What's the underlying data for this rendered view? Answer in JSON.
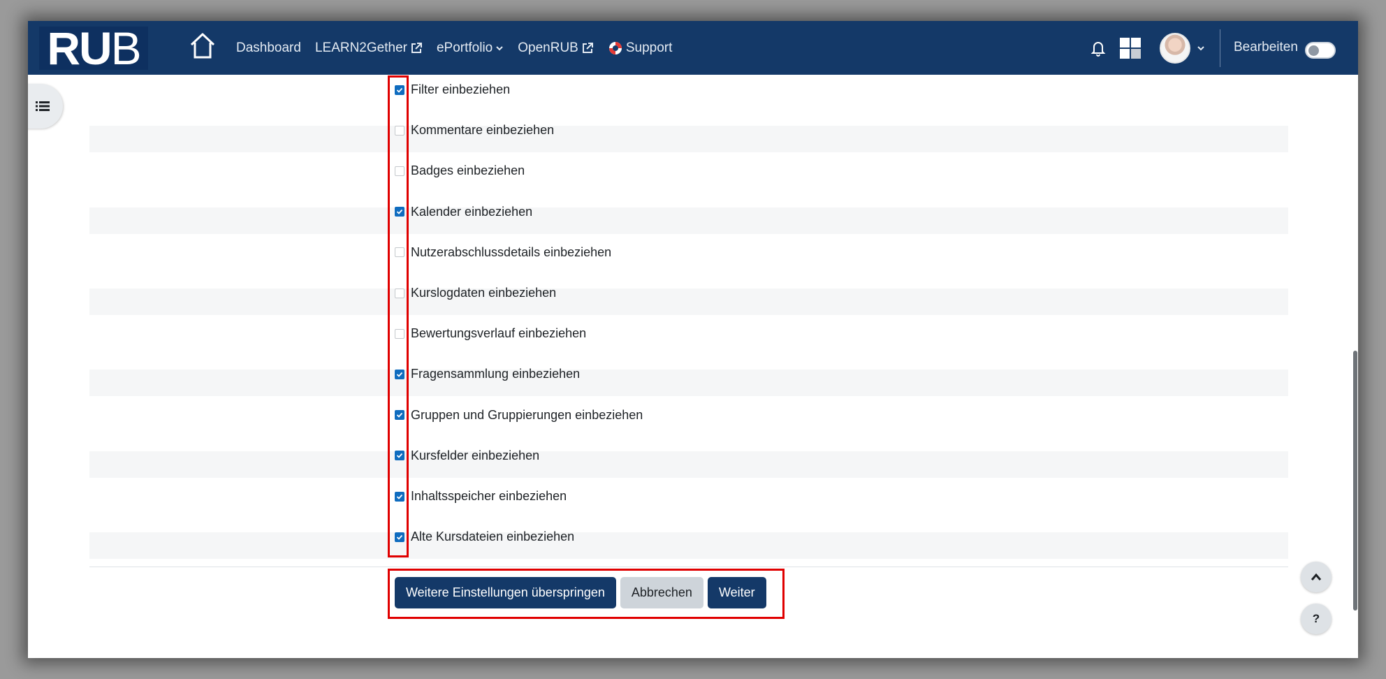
{
  "navbar": {
    "logo_text_main": "RU",
    "logo_text_end": "B",
    "links": [
      {
        "label": "Dashboard",
        "icon": ""
      },
      {
        "label": "LEARN2Gether",
        "icon": "external-link-icon"
      },
      {
        "label": "ePortfolio",
        "icon": "chevron-down-icon"
      },
      {
        "label": "OpenRUB",
        "icon": "external-link-icon"
      },
      {
        "label": "Support",
        "icon": "lifebuoy-icon"
      }
    ],
    "edit_label": "Bearbeiten",
    "edit_mode_on": false
  },
  "options": [
    {
      "label": "Filter einbeziehen",
      "checked": true
    },
    {
      "label": "Kommentare einbeziehen",
      "checked": false
    },
    {
      "label": "Badges einbeziehen",
      "checked": false
    },
    {
      "label": "Kalender einbeziehen",
      "checked": true
    },
    {
      "label": "Nutzerabschlussdetails einbeziehen",
      "checked": false
    },
    {
      "label": "Kurslogdaten einbeziehen",
      "checked": false
    },
    {
      "label": "Bewertungsverlauf einbeziehen",
      "checked": false
    },
    {
      "label": "Fragensammlung einbeziehen",
      "checked": true
    },
    {
      "label": "Gruppen und Gruppierungen einbeziehen",
      "checked": true
    },
    {
      "label": "Kursfelder einbeziehen",
      "checked": true
    },
    {
      "label": "Inhaltsspeicher einbeziehen",
      "checked": true
    },
    {
      "label": "Alte Kursdateien einbeziehen",
      "checked": true
    }
  ],
  "buttons": {
    "skip": "Weitere Einstellungen überspringen",
    "cancel": "Abbrechen",
    "next": "Weiter"
  },
  "floating": {
    "help": "?"
  },
  "colors": {
    "navbar": "#143968",
    "primary_button": "#143968",
    "checkbox_checked": "#0f6cbf",
    "highlight": "#e00000"
  }
}
